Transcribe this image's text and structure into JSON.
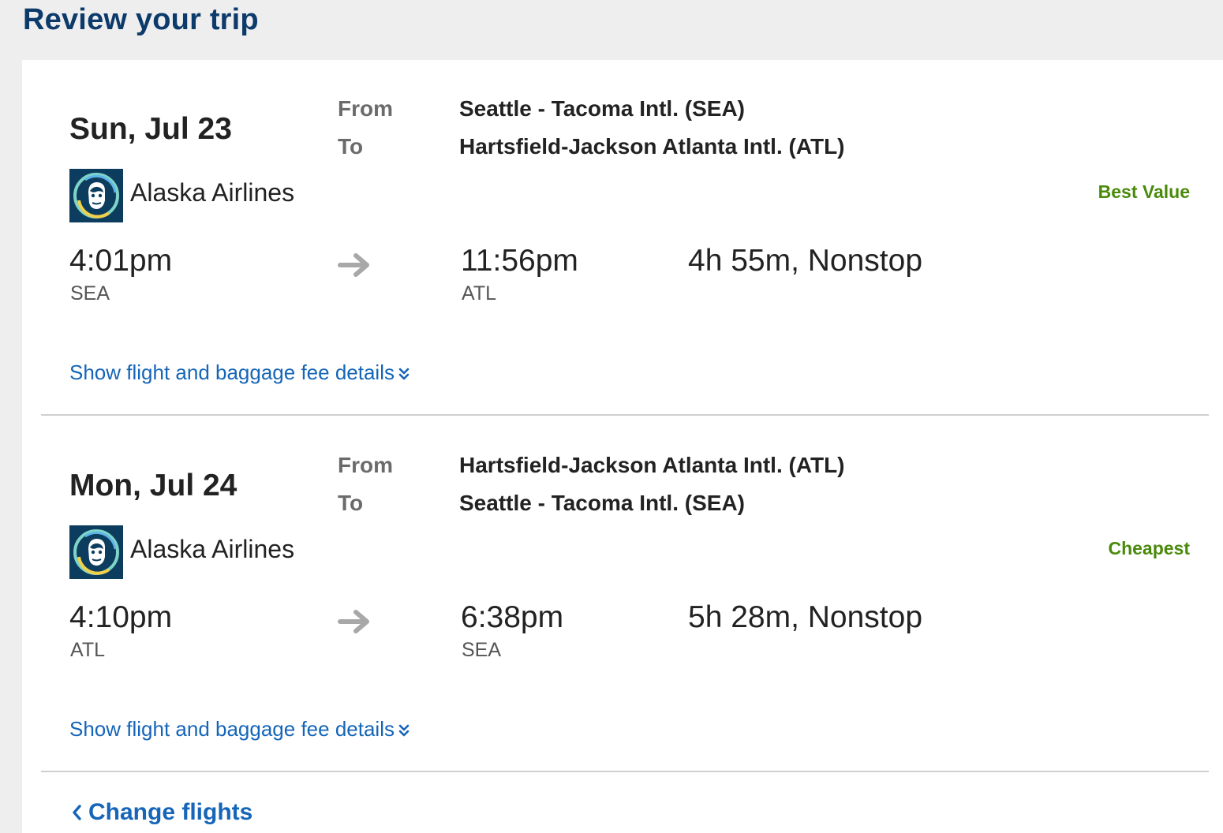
{
  "page": {
    "title": "Review your trip"
  },
  "legs": [
    {
      "date": "Sun, Jul 23",
      "from_label": "From",
      "to_label": "To",
      "from_airport": "Seattle - Tacoma Intl. (SEA)",
      "to_airport": "Hartsfield-Jackson Atlanta Intl. (ATL)",
      "airline": "Alaska Airlines",
      "airline_logo_icon": "alaska-airlines-logo-icon",
      "badge": "Best Value",
      "depart_time": "4:01pm",
      "depart_code": "SEA",
      "arrive_time": "11:56pm",
      "arrive_code": "ATL",
      "duration": "4h 55m, Nonstop",
      "details_link": "Show flight and baggage fee details"
    },
    {
      "date": "Mon, Jul 24",
      "from_label": "From",
      "to_label": "To",
      "from_airport": "Hartsfield-Jackson Atlanta Intl. (ATL)",
      "to_airport": "Seattle - Tacoma Intl. (SEA)",
      "airline": "Alaska Airlines",
      "airline_logo_icon": "alaska-airlines-logo-icon",
      "badge": "Cheapest",
      "depart_time": "4:10pm",
      "depart_code": "ATL",
      "arrive_time": "6:38pm",
      "arrive_code": "SEA",
      "duration": "5h 28m, Nonstop",
      "details_link": "Show flight and baggage fee details"
    }
  ],
  "actions": {
    "change_flights": "Change flights"
  },
  "colors": {
    "title": "#0c3a6b",
    "link": "#1565b8",
    "badge": "#4a8a0b",
    "logo_bg": "#0d3d5e"
  },
  "icons": {
    "arrow": "arrow-right-icon",
    "expand": "chevron-double-down-icon",
    "back": "chevron-left-icon"
  }
}
